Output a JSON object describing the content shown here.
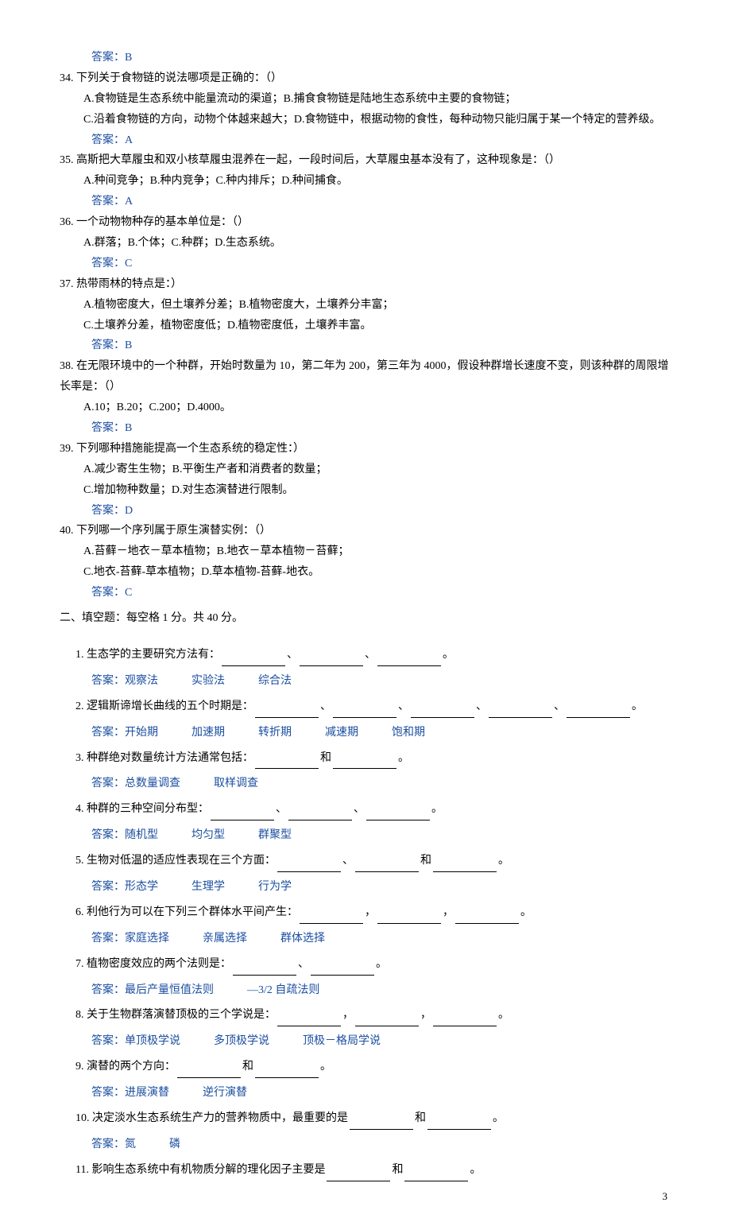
{
  "pre_answer": "答案：B",
  "mcq": [
    {
      "num": "34.",
      "text": "下列关于食物链的说法哪项是正确的：（）",
      "opts": [
        "A.食物链是生态系统中能量流动的渠道；B.捕食食物链是陆地生态系统中主要的食物链；",
        "C.沿着食物链的方向，动物个体越来越大；D.食物链中，根据动物的食性，每种动物只能归属于某一个特定的营养级。"
      ],
      "ans": "答案：A"
    },
    {
      "num": "35.",
      "text": "高斯把大草履虫和双小核草履虫混养在一起，一段时间后，大草履虫基本没有了，这种现象是：（）",
      "opts": [
        "A.种间竞争；B.种内竞争；C.种内排斥；D.种间捕食。"
      ],
      "ans": "答案：A"
    },
    {
      "num": "36.",
      "text": "一个动物物种存的基本单位是：（）",
      "opts": [
        "A.群落；B.个体；C.种群；D.生态系统。"
      ],
      "ans": "答案：C"
    },
    {
      "num": "37.",
      "text": "热带雨林的特点是：）",
      "opts": [
        "A.植物密度大，但土壤养分差；B.植物密度大，土壤养分丰富；",
        "C.土壤养分差，植物密度低；D.植物密度低，土壤养丰富。"
      ],
      "ans": "答案：B"
    },
    {
      "num": "38.",
      "text": "在无限环境中的一个种群，开始时数量为 10，第二年为 200，第三年为 4000，假设种群增长速度不变，则该种群的周限增长率是：（）",
      "opts": [
        "A.10；B.20；C.200；D.4000。"
      ],
      "ans": "答案：B"
    },
    {
      "num": "39.",
      "text": "下列哪种措施能提高一个生态系统的稳定性：）",
      "opts": [
        "A.减少寄生生物；B.平衡生产者和消费者的数量；",
        "C.增加物种数量；D.对生态演替进行限制。"
      ],
      "ans": "答案：D"
    },
    {
      "num": "40.",
      "text": "下列哪一个序列属于原生演替实例：（）",
      "opts": [
        "A.苔藓－地衣－草本植物；B.地衣－草本植物－苔藓；",
        "C.地衣-苔藓-草本植物；D.草本植物-苔藓-地衣。"
      ],
      "ans": "答案：C"
    }
  ],
  "section2": "二、填空题：每空格 1 分。共 40 分。",
  "fill": [
    {
      "num": "1.",
      "prefix": "生态学的主要研究方法有：",
      "blanks": [
        "",
        "、",
        "",
        "、",
        "",
        "。"
      ],
      "ans": "答案：观察法　　　实验法　　　综合法"
    },
    {
      "num": "2.",
      "prefix": "逻辑斯谛增长曲线的五个时期是：",
      "blanks": [
        "",
        "、",
        "",
        "、",
        "",
        "、",
        "",
        "、",
        "",
        "。"
      ],
      "ans": "答案：开始期　　　加速期　　　转折期　　　减速期　　　饱和期"
    },
    {
      "num": "3.",
      "prefix": "种群绝对数量统计方法通常包括：",
      "blanks": [
        "",
        "和",
        "",
        "。"
      ],
      "ans": "答案：总数量调查　　　取样调查"
    },
    {
      "num": "4.",
      "prefix": "种群的三种空间分布型：",
      "blanks": [
        "",
        "、",
        "",
        "、",
        "",
        "。"
      ],
      "ans": "答案：随机型　　　均匀型　　　群聚型"
    },
    {
      "num": "5.",
      "prefix": "生物对低温的适应性表现在三个方面：",
      "blanks": [
        "",
        "、",
        "",
        "和",
        "",
        "。"
      ],
      "ans": "答案：形态学　　　生理学　　　行为学"
    },
    {
      "num": "6.",
      "prefix": "利他行为可以在下列三个群体水平间产生：",
      "blanks": [
        "",
        "，",
        "",
        "，",
        "",
        "。"
      ],
      "ans": "答案：家庭选择　　　亲属选择　　　群体选择"
    },
    {
      "num": "7.",
      "prefix": "植物密度效应的两个法则是：",
      "blanks": [
        "",
        "、",
        "",
        "。"
      ],
      "ans": "答案：最后产量恒值法则　　　—3/2 自疏法则"
    },
    {
      "num": "8.",
      "prefix": "关于生物群落演替顶极的三个学说是：",
      "blanks": [
        "",
        "，",
        "",
        "，",
        "",
        "。"
      ],
      "ans": "答案：单顶极学说　　　多顶极学说　　　顶极－格局学说"
    },
    {
      "num": "9.",
      "prefix": "演替的两个方向：",
      "blanks": [
        "",
        "和",
        "",
        "。"
      ],
      "ans": "答案：进展演替　　　逆行演替"
    },
    {
      "num": "10.",
      "prefix": "决定淡水生态系统生产力的营养物质中，最重要的是",
      "blanks": [
        "",
        "和",
        "",
        "。"
      ],
      "ans": "答案：氮　　　磷"
    },
    {
      "num": "11.",
      "prefix": "影响生态系统中有机物质分解的理化因子主要是",
      "blanks": [
        "",
        "和",
        "",
        "。"
      ],
      "ans": ""
    }
  ],
  "page_num": "3"
}
